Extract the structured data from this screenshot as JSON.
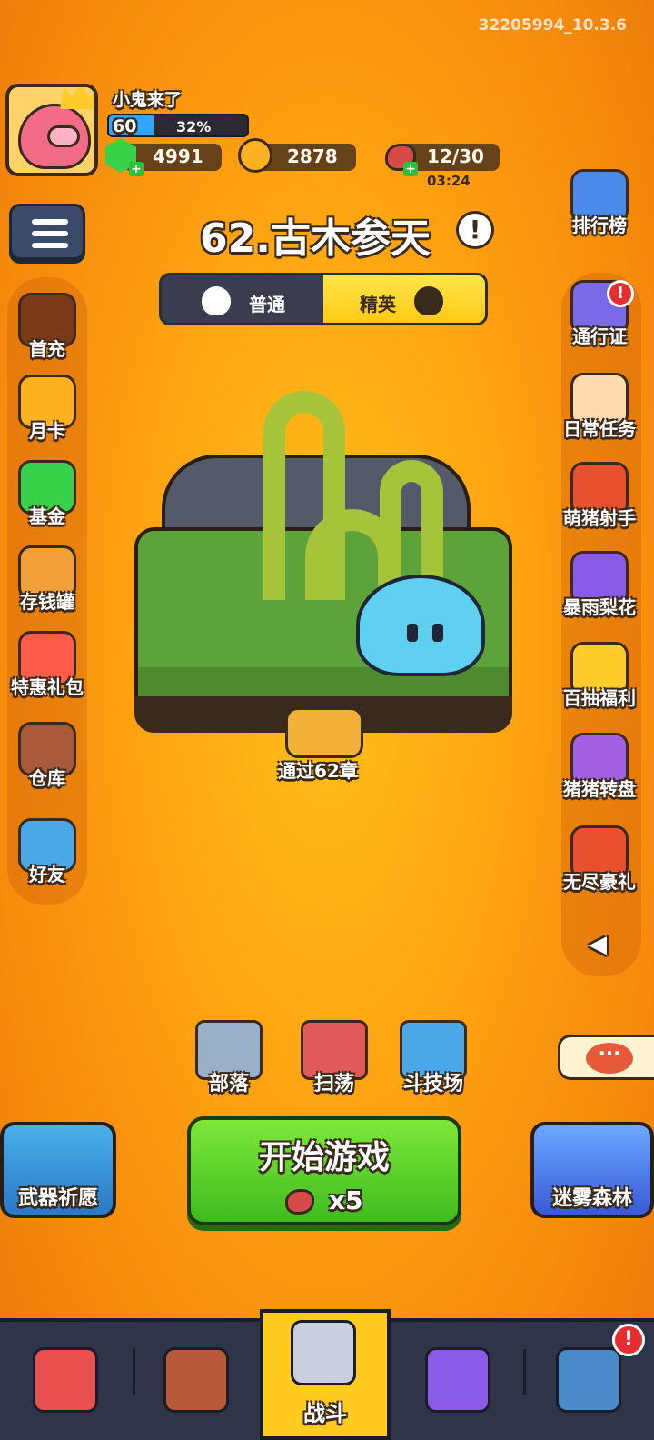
{
  "build_version": "32205994_10.3.6",
  "player": {
    "name": "小鬼来了",
    "level": "60",
    "exp_percent": "32%",
    "exp_fraction": 0.32
  },
  "resources": {
    "gems": "4991",
    "coins": "2878",
    "stamina": "12/30",
    "stamina_timer": "03:24"
  },
  "stage": {
    "title": "62.古木参天",
    "mode_normal": "普通",
    "mode_elite": "精英",
    "selected_mode": "精英",
    "reward_label": "通过62章"
  },
  "left_menu": [
    {
      "label": "首充",
      "icon": "first-recharge-icon"
    },
    {
      "label": "月卡",
      "icon": "monthly-card-icon"
    },
    {
      "label": "基金",
      "icon": "fund-icon"
    },
    {
      "label": "存钱罐",
      "icon": "piggy-bank-icon"
    },
    {
      "label": "特惠礼包",
      "icon": "gift-box-icon"
    },
    {
      "label": "仓库",
      "icon": "backpack-icon"
    },
    {
      "label": "好友",
      "icon": "friends-icon"
    }
  ],
  "right_menu": [
    {
      "label": "排行榜",
      "icon": "leaderboard-icon"
    },
    {
      "label": "通行证",
      "icon": "pass-icon",
      "badge": "!"
    },
    {
      "label": "日常任务",
      "icon": "scroll-icon"
    },
    {
      "label": "萌猪射手",
      "icon": "firecracker-icon"
    },
    {
      "label": "暴雨梨花",
      "icon": "arrows-icon"
    },
    {
      "label": "百抽福利",
      "icon": "crown-icon"
    },
    {
      "label": "猪猪转盘",
      "icon": "wheel-icon"
    },
    {
      "label": "无尽豪礼",
      "icon": "treasure-chest-icon"
    }
  ],
  "collapse_arrow": "◀",
  "actions": {
    "tribe": "部落",
    "sweep": "扫荡",
    "arena": "斗技场",
    "weapon_wish": "武器祈愿",
    "misty_forest": "迷雾森林",
    "start_game": "开始游戏",
    "start_cost": "x5"
  },
  "chat_icon_text": "···",
  "bottom_nav": {
    "battle_label": "战斗",
    "shop_badge": "!"
  },
  "colors": {
    "background": "#ffa412",
    "start_button": "#3fbc1f",
    "elite_tab": "#ffcb1f",
    "badge": "#e62e2e"
  }
}
